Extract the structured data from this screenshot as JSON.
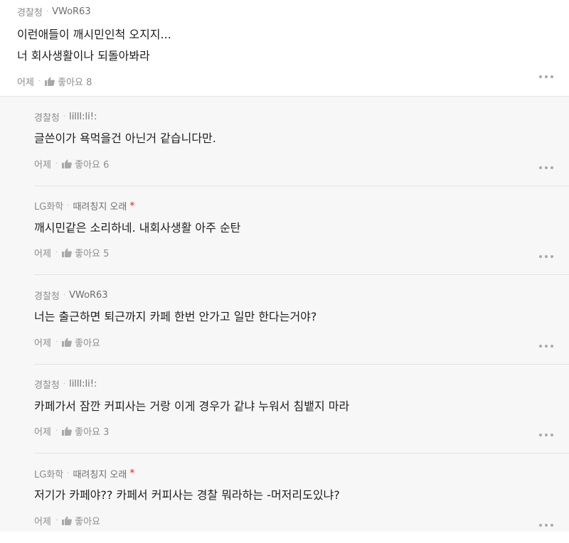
{
  "top_comment": {
    "author": "경찰청",
    "nickname": "VWoR63",
    "lines": [
      "이런애들이 깨시민인척 오지지...",
      "너 회사생활이나 되돌아봐라"
    ],
    "time": "어제",
    "like_label": "좋아요 8"
  },
  "replies": [
    {
      "author": "경찰청",
      "nickname": "lilll:li!:",
      "text": "글쓴이가 욕먹을건 아닌거 같습니다만.",
      "time": "어제",
      "like_label": "좋아요 6",
      "mark": ""
    },
    {
      "author": "LG화학",
      "nickname": "때려칭지 오래",
      "text": "깨시민같은 소리하네. 내회사생활 아주 순탄",
      "time": "어제",
      "like_label": "좋아요 5",
      "mark": "*"
    },
    {
      "author": "경찰청",
      "nickname": "VWoR63",
      "text": "너는 출근하면 퇴근까지 카페 한번 안가고  일만 한다는거야?",
      "time": "어제",
      "like_label": "좋아요",
      "mark": ""
    },
    {
      "author": "경찰청",
      "nickname": "lilll:li!:",
      "text": "카페가서 잠깐 커피사는 거랑 이게 경우가 같냐 누워서 침뱉지 마라",
      "time": "어제",
      "like_label": "좋아요 3",
      "mark": ""
    },
    {
      "author": "LG화학",
      "nickname": "때려칭지 오래",
      "text": "저기가 카페야?? 카페서 커피사는 경찰 뭐라하는 -머저리도있냐?",
      "time": "어제",
      "like_label": "좋아요",
      "mark": "*"
    }
  ],
  "icons": {
    "like": "thumbs-up-icon",
    "more": "more-dots-icon"
  },
  "colors": {
    "text": "#1e1e1e",
    "meta": "#8c8c8c",
    "reply_bg": "#f7f7f8",
    "mark": "#e0241b"
  }
}
